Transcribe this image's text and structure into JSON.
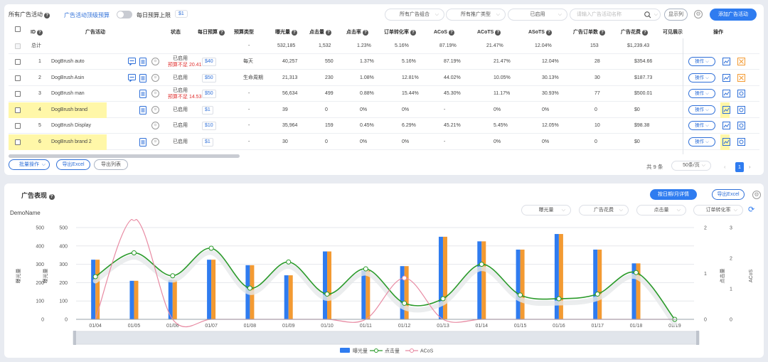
{
  "toolbar": {
    "title": "所有广告活动",
    "budget_link": "广告活动顶级预算",
    "daily_cap_label": "每日预算上限",
    "daily_cap_value": "$1",
    "filters": [
      "所有广告组合",
      "所有推广类型",
      "已启用"
    ],
    "search_placeholder": "请输入广告活动名称",
    "display_btn": "显示列",
    "add_btn": "添加广告活动"
  },
  "table": {
    "headers": {
      "id": "ID",
      "campaign": "广告活动",
      "status": "状态",
      "daily_budget": "每日预算",
      "budget_type": "预算类型",
      "impressions": "曝光量",
      "clicks": "点击量",
      "ctr": "点击率",
      "cvr": "订单转化率",
      "acos": "ACoS",
      "acots": "ACoTS",
      "asots": "ASoTS",
      "orders": "广告订单数",
      "spend": "广告花费",
      "visible": "可见展示",
      "ops": "操作"
    },
    "total": {
      "label": "总计",
      "budget_type": "-",
      "impressions": "532,185",
      "clicks": "1,532",
      "ctr": "1.23%",
      "cvr": "5.16%",
      "acos": "87.19%",
      "acots": "21.47%",
      "asots": "12.04%",
      "orders": "153",
      "spend": "$1,239.43"
    },
    "rows": [
      {
        "id": "1",
        "name": "DogBrush auto",
        "status": "已启用",
        "warn": "预算不足 20.41",
        "budget": "$40",
        "budget_type": "每天",
        "impressions": "40,257",
        "clicks": "550",
        "ctr": "1.37%",
        "cvr": "5.16%",
        "acos": "87.19%",
        "acots": "21.47%",
        "asots": "12.04%",
        "orders": "28",
        "spend": "$354.66",
        "op": "操作"
      },
      {
        "id": "2",
        "name": "DogBrush Asin",
        "status": "已启用",
        "warn": "",
        "budget": "$50",
        "budget_type": "生命周期",
        "impressions": "21,313",
        "clicks": "230",
        "ctr": "1.08%",
        "cvr": "12.81%",
        "acos": "44.02%",
        "acots": "10.05%",
        "asots": "30.13%",
        "orders": "30",
        "spend": "$187.73",
        "op": "操作"
      },
      {
        "id": "3",
        "name": "DogBrush man",
        "status": "已启用",
        "warn": "预算不足 14.53",
        "budget": "$50",
        "budget_type": "-",
        "impressions": "56,634",
        "clicks": "499",
        "ctr": "0.88%",
        "cvr": "15.44%",
        "acos": "45.30%",
        "acots": "11.17%",
        "asots": "30.93%",
        "orders": "77",
        "spend": "$500.01",
        "op": "操作"
      },
      {
        "id": "4",
        "name": "DogBrush brand",
        "status": "已启用",
        "warn": "",
        "budget": "$1",
        "budget_type": "-",
        "impressions": "39",
        "clicks": "0",
        "ctr": "0%",
        "cvr": "0%",
        "acos": "-",
        "acots": "0%",
        "asots": "0%",
        "orders": "0",
        "spend": "$0",
        "op": "操作"
      },
      {
        "id": "5",
        "name": "DogBrush Display",
        "status": "已启用",
        "warn": "",
        "budget": "$10",
        "budget_type": "-",
        "impressions": "35,964",
        "clicks": "159",
        "ctr": "0.45%",
        "cvr": "6.29%",
        "acos": "45.21%",
        "acots": "5.45%",
        "asots": "12.05%",
        "orders": "10",
        "spend": "$98.38",
        "op": "操作"
      },
      {
        "id": "6",
        "name": "DogBrush brand 2",
        "status": "已启用",
        "warn": "",
        "budget": "$1",
        "budget_type": "-",
        "impressions": "30",
        "clicks": "0",
        "ctr": "0%",
        "cvr": "0%",
        "acos": "-",
        "acots": "0%",
        "asots": "0%",
        "orders": "0",
        "spend": "$0",
        "op": "操作"
      }
    ]
  },
  "footer": {
    "bulk": "批量操作",
    "export_excel": "导出Excel",
    "export_list": "导出列表",
    "total": "共 9 条",
    "page_size": "50条/页",
    "page": "1"
  },
  "chart_panel": {
    "title": "广告表现",
    "daily_btn": "按日期/月详情",
    "export_btn": "导出Excel",
    "selects": [
      "曝光量",
      "广告花费",
      "点击量",
      "订单转化率"
    ]
  },
  "chart_data": {
    "type": "bar",
    "title": "DemoName",
    "categories": [
      "01/04",
      "01/05",
      "01/06",
      "01/07",
      "01/08",
      "01/09",
      "01/10",
      "01/11",
      "01/12",
      "01/13",
      "01/14",
      "01/15",
      "01/16",
      "01/17",
      "01/18",
      "01/19"
    ],
    "series": [
      {
        "name": "曝光量",
        "type": "bar",
        "axis": "left",
        "color": "#2f7cf0",
        "values": [
          325,
          210,
          215,
          325,
          295,
          240,
          370,
          265,
          290,
          450,
          425,
          380,
          465,
          380,
          305,
          0
        ]
      },
      {
        "name": "曝光量 (orange)",
        "type": "bar",
        "axis": "left2",
        "color": "#f39a32",
        "values": [
          325,
          210,
          215,
          325,
          295,
          240,
          370,
          265,
          290,
          450,
          425,
          380,
          465,
          380,
          305,
          0
        ]
      },
      {
        "name": "点击量",
        "type": "line",
        "axis": "right",
        "color": "#2a9a2a",
        "values": [
          0.93,
          1.45,
          0.95,
          1.55,
          0.68,
          1.25,
          0.55,
          1.1,
          0.35,
          0.45,
          1.2,
          0.53,
          0.45,
          0.55,
          1.02,
          0.0
        ]
      },
      {
        "name": "ACoS",
        "type": "line",
        "axis": "right2",
        "color": "#e88aa2",
        "values": [
          0,
          3.3,
          0,
          0,
          0,
          0,
          0,
          0,
          1.35,
          0,
          0,
          0,
          0,
          0,
          0,
          0
        ]
      }
    ],
    "ylabel_left": "曝光量",
    "ylabel_left2": "曝光量",
    "ylabel_right": "点击量",
    "ylabel_right2": "ACoS",
    "ylim_left": [
      0,
      500
    ],
    "ylim_right": [
      0,
      2
    ],
    "ylim_right2": [
      0,
      3
    ],
    "yticks_left": [
      "0",
      "100",
      "200",
      "300",
      "400",
      "500"
    ],
    "yticks_right": [
      "0",
      "1",
      "2"
    ],
    "yticks_right2": [
      "0",
      "1",
      "2",
      "3"
    ],
    "legend": [
      "曝光量",
      "点击量",
      "ACoS"
    ],
    "grid": true,
    "legend_position": "bottom-center"
  }
}
